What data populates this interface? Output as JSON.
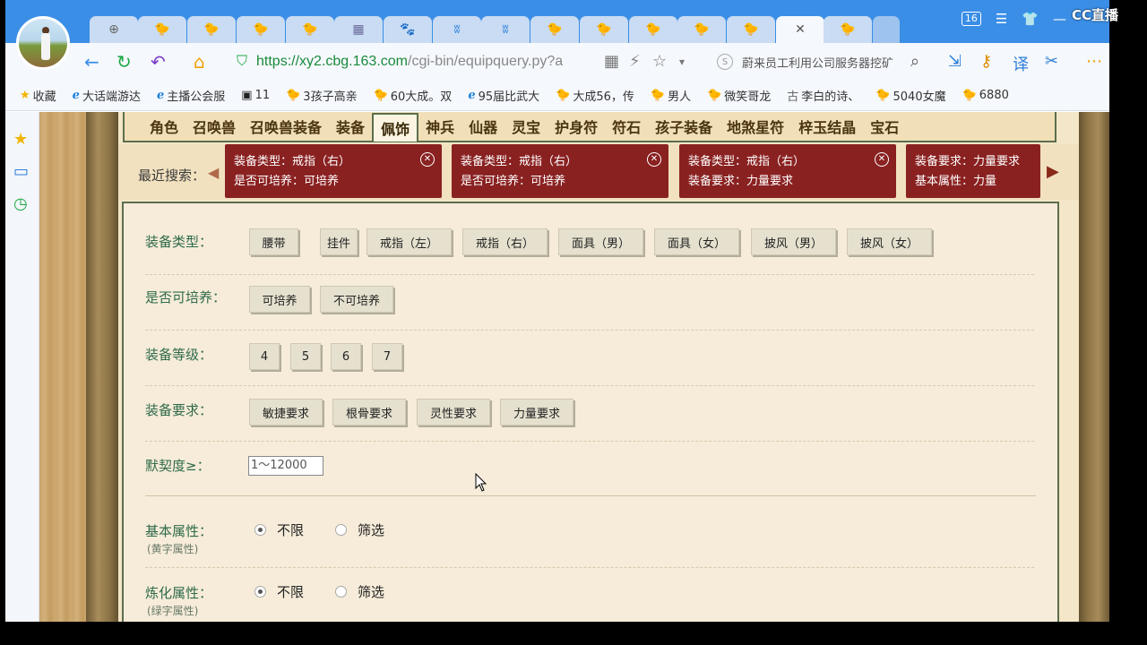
{
  "browser": {
    "tabs": [
      {
        "icon": "globe-icon",
        "glyph": "⊕"
      },
      {
        "icon": "chick-icon",
        "glyph": "🐤"
      },
      {
        "icon": "chick-icon",
        "glyph": "🐤"
      },
      {
        "icon": "chick-icon",
        "glyph": "🐤"
      },
      {
        "icon": "chick-icon",
        "glyph": "🐤"
      },
      {
        "icon": "grid-icon",
        "glyph": "▦"
      },
      {
        "icon": "paw-icon",
        "glyph": "🐾"
      },
      {
        "icon": "butterfly-icon",
        "glyph": "ʬ"
      },
      {
        "icon": "butterfly-icon",
        "glyph": "ʬ"
      },
      {
        "icon": "chick-icon",
        "glyph": "🐤"
      },
      {
        "icon": "chick-icon",
        "glyph": "🐤"
      },
      {
        "icon": "chick-icon",
        "glyph": "🐤"
      },
      {
        "icon": "chick-icon",
        "glyph": "🐤"
      },
      {
        "icon": "chick-icon",
        "glyph": "🐤"
      },
      {
        "icon": "close-icon",
        "glyph": "✕",
        "active": true
      },
      {
        "icon": "chick-icon",
        "glyph": "🐤"
      }
    ],
    "tab_count": "16",
    "watermark": "CC直播",
    "url": {
      "host": "https://xy2.cbg.163.com",
      "path": "/cgi-bin/equipquery.py?a"
    },
    "news_text": "蔚来员工利用公司服务器挖矿",
    "bookmarks": [
      {
        "label": "收藏",
        "icon": "star-icon"
      },
      {
        "label": "大话端游达",
        "icon": "e-icon"
      },
      {
        "label": "主播公会服",
        "icon": "e-icon"
      },
      {
        "label": "11",
        "icon": "image-icon"
      },
      {
        "label": "3孩子高亲",
        "icon": "chick-icon"
      },
      {
        "label": "60大成。双",
        "icon": "chick-icon"
      },
      {
        "label": "95届比武大",
        "icon": "e-icon"
      },
      {
        "label": "大成56，传",
        "icon": "chick-icon"
      },
      {
        "label": "男人",
        "icon": "chick-icon"
      },
      {
        "label": "微笑哥龙",
        "icon": "chick-icon"
      },
      {
        "label": "李白的诗、",
        "icon": "gu-icon"
      },
      {
        "label": "5040女魔",
        "icon": "chick-icon"
      },
      {
        "label": "6880",
        "icon": "chick-icon"
      }
    ]
  },
  "categories": [
    "角色",
    "召唤兽",
    "召唤兽装备",
    "装备",
    "佩饰",
    "神兵",
    "仙器",
    "灵宝",
    "护身符",
    "符石",
    "孩子装备",
    "地煞星符",
    "梓玉结晶",
    "宝石"
  ],
  "active_category": "佩饰",
  "recent": {
    "label": "最近搜索：",
    "chips": [
      {
        "line1": "装备类型：戒指（右）",
        "line2": "是否可培养：可培养"
      },
      {
        "line1": "装备类型：戒指（右）",
        "line2": "是否可培养：可培养"
      },
      {
        "line1": "装备类型：戒指（右）",
        "line2": "装备要求：力量要求"
      },
      {
        "line1": "装备要求：力量要求",
        "line2": "基本属性：力量"
      }
    ]
  },
  "filters": {
    "type": {
      "label": "装备类型：",
      "options": [
        "腰带",
        "挂件",
        "戒指（左）",
        "戒指（右）",
        "面具（男）",
        "面具（女）",
        "披风（男）",
        "披风（女）"
      ]
    },
    "trainable": {
      "label": "是否可培养：",
      "options": [
        "可培养",
        "不可培养"
      ]
    },
    "level": {
      "label": "装备等级：",
      "options": [
        "4",
        "5",
        "6",
        "7"
      ]
    },
    "requirement": {
      "label": "装备要求：",
      "options": [
        "敏捷要求",
        "根骨要求",
        "灵性要求",
        "力量要求"
      ]
    },
    "bond": {
      "label": "默契度≥：",
      "placeholder": "1～12000"
    },
    "basic_attr": {
      "label": "基本属性：",
      "sub": "(黄字属性)",
      "opt1": "不限",
      "opt2": "筛选",
      "selected": "不限"
    },
    "refine_attr": {
      "label": "炼化属性：",
      "sub": "(绿字属性)",
      "opt1": "不限",
      "opt2": "筛选",
      "selected": "不限"
    }
  }
}
